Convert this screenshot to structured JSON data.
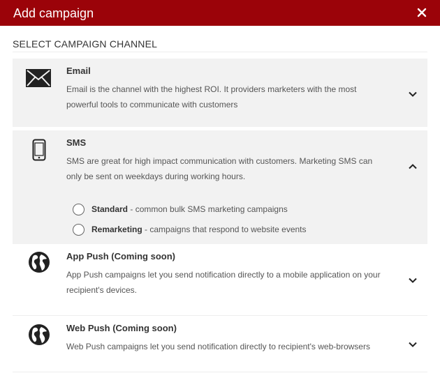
{
  "dialog": {
    "title": "Add campaign",
    "close_label": "×"
  },
  "section": {
    "title": "SELECT CAMPAIGN CHANNEL"
  },
  "channels": [
    {
      "title": "Email",
      "description": "Email is the channel with the highest ROI. It providers marketers with the most powerful tools to communicate with customers",
      "icon": "envelope-icon",
      "expanded": false
    },
    {
      "title": "SMS",
      "description": "SMS are great for high impact communication with customers. Marketing SMS can only be sent on weekdays during working hours.",
      "icon": "mobile-phone-icon",
      "expanded": true,
      "options": [
        {
          "label": "Standard",
          "separator": " - ",
          "detail": "common bulk SMS marketing campaigns",
          "selected": false
        },
        {
          "label": "Remarketing",
          "separator": " - ",
          "detail": "campaigns that respond to website events",
          "selected": false
        }
      ]
    },
    {
      "title": "App Push (Coming soon)",
      "description": "App Push campaigns let you send notification directly to a mobile application on your recipient's devices.",
      "icon": "globe-icon",
      "expanded": false
    },
    {
      "title": "Web Push (Coming soon)",
      "description": "Web Push campaigns let you send notification directly to recipient's web-browsers",
      "icon": "globe-icon",
      "expanded": false
    }
  ],
  "colors": {
    "header_bg": "#9b0309",
    "active_row_bg": "#f2f2f2"
  }
}
